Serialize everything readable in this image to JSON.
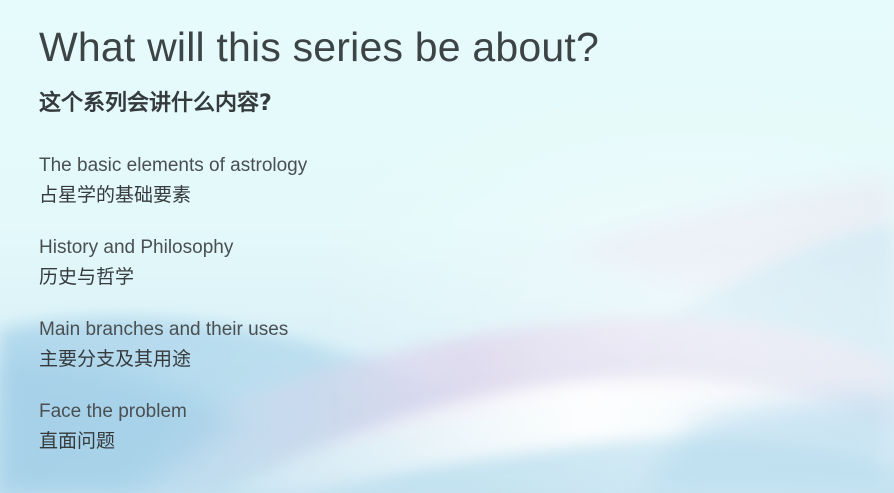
{
  "slide": {
    "title": "What will this series be about?",
    "subtitle": "这个系列会讲什么内容?",
    "items": [
      {
        "en": "The basic elements of astrology",
        "zh": "占星学的基础要素"
      },
      {
        "en": "History and Philosophy",
        "zh": "历史与哲学"
      },
      {
        "en": "Main branches and their uses",
        "zh": "主要分支及其用途"
      },
      {
        "en": "Face the problem",
        "zh": "直面问题"
      }
    ]
  },
  "colors": {
    "background_top": "#e8fbfb",
    "wave_blue": "#a9d4ec",
    "wave_lilac": "#d9d2ea",
    "wave_white": "#f7fbfc",
    "text": "#3d4446"
  }
}
